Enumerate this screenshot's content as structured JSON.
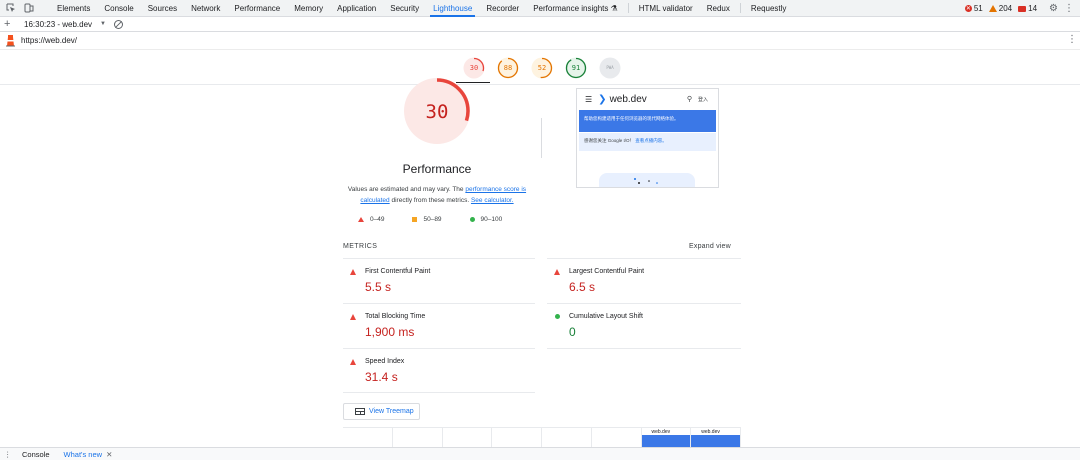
{
  "devtools": {
    "tabs": [
      {
        "label": "Elements"
      },
      {
        "label": "Console"
      },
      {
        "label": "Sources"
      },
      {
        "label": "Network"
      },
      {
        "label": "Performance"
      },
      {
        "label": "Memory"
      },
      {
        "label": "Application"
      },
      {
        "label": "Security"
      },
      {
        "label": "Lighthouse"
      },
      {
        "label": "Recorder"
      },
      {
        "label": "Performance insights ⚗"
      },
      {
        "label": "HTML validator"
      },
      {
        "label": "Redux"
      },
      {
        "label": "Requestly"
      }
    ],
    "active_tab": "Lighthouse",
    "errors": "51",
    "warnings": "204",
    "issues": "14"
  },
  "toolbar": {
    "report_label": "16:30:23 - web.dev"
  },
  "urlbar": {
    "url": "https://web.dev/"
  },
  "scores": [
    {
      "value": "30",
      "color": "#e8453c",
      "ring": "#fce8e6"
    },
    {
      "value": "88",
      "color": "#e37400",
      "ring": "#fef3e0"
    },
    {
      "value": "52",
      "color": "#e37400",
      "ring": "#fef3e0"
    },
    {
      "value": "91",
      "color": "#188038",
      "ring": "#e6f4ea"
    },
    {
      "value": "PWA",
      "color": "#9aa0a6",
      "ring": "#e8eaed"
    }
  ],
  "performance": {
    "score": "30",
    "score_fraction": 0.3,
    "title": "Performance",
    "desc_prefix": "Values are estimated and may vary. The",
    "desc_link1": "performance score is calculated",
    "desc_mid": "directly from these metrics.",
    "desc_link2": "See calculator."
  },
  "legend": {
    "bad": "0–49",
    "avg": "50–89",
    "good": "90–100"
  },
  "screenshot": {
    "brand": "web.dev",
    "login": "登入",
    "banner": "帮助您构建适用于任何浏览器的现代网络体验。",
    "note": "感谢您关注 Google I/O！",
    "note_link": "查看点播内容。"
  },
  "metrics": {
    "label": "METRICS",
    "expand": "Expand view",
    "items": [
      {
        "name": "First Contentful Paint",
        "value": "5.5 s",
        "status": "bad"
      },
      {
        "name": "Largest Contentful Paint",
        "value": "6.5 s",
        "status": "bad"
      },
      {
        "name": "Total Blocking Time",
        "value": "1,900 ms",
        "status": "bad"
      },
      {
        "name": "Cumulative Layout Shift",
        "value": "0",
        "status": "good"
      },
      {
        "name": "Speed Index",
        "value": "31.4 s",
        "status": "bad"
      }
    ]
  },
  "treemap": {
    "label": "View Treemap"
  },
  "filmstrip": {
    "frame_brand": "web.dev"
  },
  "drawer": {
    "console": "Console",
    "whats_new": "What's new"
  }
}
